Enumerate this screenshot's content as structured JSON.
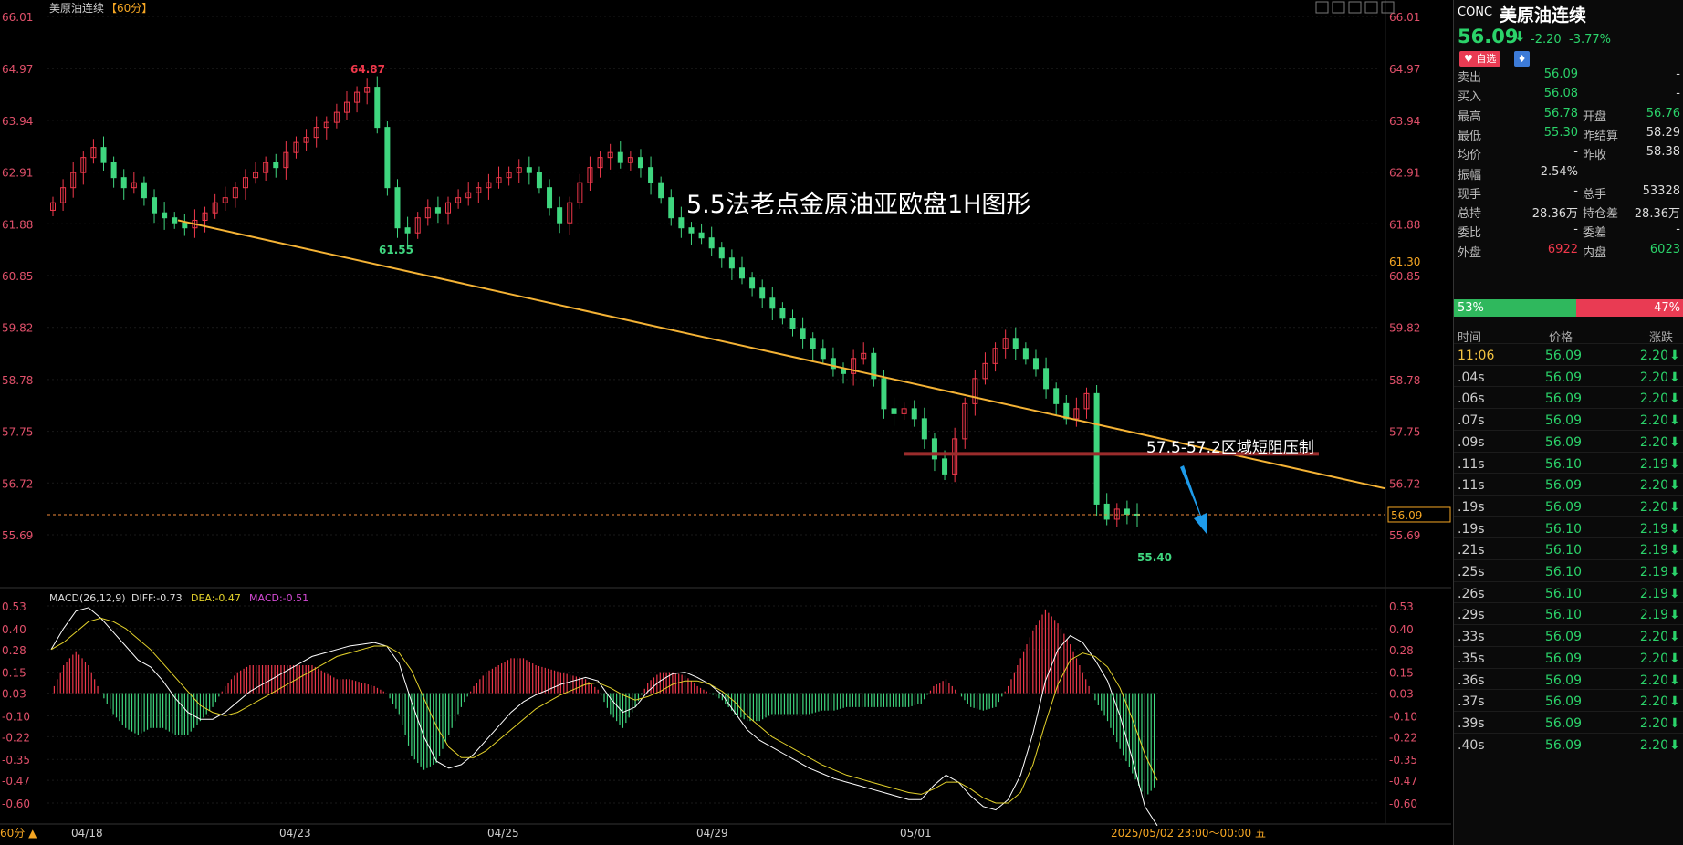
{
  "chart": {
    "title_symbol": "美原油连续",
    "title_period": "【60分】",
    "annotation_title": "5.5法老点金原油亚欧盘1H图形",
    "annotation_zone": "57.5-57.2区域短阻压制",
    "high_label": "64.87",
    "low_label_1": "61.55",
    "low_label_2": "55.40",
    "current_price_tag": "56.09",
    "crosshair_price_tag": "61.30",
    "period_button": "60分 ▲",
    "date_footer": "2025/05/02 23:00～00:00 五",
    "toolbar_icons": [
      "grid-icon",
      "split-icon",
      "zoom-icon",
      "panel-icon",
      "settings-icon"
    ]
  },
  "macd": {
    "label": "MACD(26,12,9)",
    "diff": "DIFF:-0.73",
    "dea": "DEA:-0.47",
    "macd": "MACD:-0.51"
  },
  "chart_data": {
    "type": "candlestick",
    "price_axis_ticks": [
      "66.01",
      "64.97",
      "63.94",
      "62.91",
      "61.88",
      "60.85",
      "59.82",
      "58.78",
      "57.75",
      "56.72",
      "55.69"
    ],
    "macd_axis_ticks": [
      "0.53",
      "0.40",
      "0.28",
      "0.15",
      "0.03",
      "-0.10",
      "-0.22",
      "-0.35",
      "-0.47",
      "-0.60"
    ],
    "date_ticks": [
      "04/18",
      "04/23",
      "04/25",
      "04/29",
      "05/01"
    ],
    "ylim": [
      55.4,
      66.01
    ],
    "closes": [
      62.3,
      62.6,
      62.9,
      63.2,
      63.4,
      63.1,
      62.8,
      62.6,
      62.7,
      62.4,
      62.1,
      62.0,
      61.9,
      61.8,
      61.95,
      62.1,
      62.3,
      62.4,
      62.6,
      62.8,
      62.9,
      63.1,
      63.0,
      63.3,
      63.5,
      63.6,
      63.8,
      63.9,
      64.1,
      64.3,
      64.5,
      64.6,
      63.8,
      62.6,
      61.8,
      61.7,
      62.0,
      62.2,
      62.1,
      62.3,
      62.4,
      62.5,
      62.6,
      62.7,
      62.8,
      62.9,
      63.0,
      62.9,
      62.6,
      62.2,
      61.9,
      62.3,
      62.7,
      63.0,
      63.2,
      63.3,
      63.1,
      63.2,
      63.0,
      62.7,
      62.4,
      62.0,
      61.8,
      61.7,
      61.6,
      61.4,
      61.2,
      61.0,
      60.8,
      60.6,
      60.4,
      60.2,
      60.0,
      59.8,
      59.6,
      59.4,
      59.2,
      59.0,
      58.9,
      59.2,
      59.3,
      58.8,
      58.2,
      58.1,
      58.2,
      58.0,
      57.6,
      57.2,
      56.9,
      57.6,
      58.3,
      58.8,
      59.1,
      59.4,
      59.6,
      59.4,
      59.2,
      59.0,
      58.6,
      58.3,
      58.0,
      58.2,
      58.5,
      56.3,
      56.0,
      56.2,
      56.1,
      56.09
    ],
    "series": [
      {
        "name": "DIFF",
        "values": [
          0.28,
          0.4,
          0.5,
          0.52,
          0.46,
          0.38,
          0.3,
          0.22,
          0.18,
          0.1,
          0.0,
          -0.08,
          -0.12,
          -0.12,
          -0.08,
          -0.02,
          0.04,
          0.08,
          0.12,
          0.16,
          0.2,
          0.24,
          0.26,
          0.28,
          0.3,
          0.31,
          0.32,
          0.3,
          0.2,
          -0.02,
          -0.22,
          -0.36,
          -0.4,
          -0.38,
          -0.32,
          -0.24,
          -0.16,
          -0.08,
          -0.02,
          0.02,
          0.05,
          0.08,
          0.1,
          0.12,
          0.1,
          0.0,
          -0.08,
          -0.05,
          0.04,
          0.1,
          0.14,
          0.15,
          0.12,
          0.08,
          0.02,
          -0.08,
          -0.18,
          -0.24,
          -0.28,
          -0.32,
          -0.36,
          -0.4,
          -0.43,
          -0.46,
          -0.48,
          -0.5,
          -0.52,
          -0.54,
          -0.56,
          -0.58,
          -0.58,
          -0.5,
          -0.44,
          -0.48,
          -0.56,
          -0.62,
          -0.64,
          -0.58,
          -0.44,
          -0.2,
          0.1,
          0.28,
          0.36,
          0.32,
          0.22,
          0.1,
          -0.1,
          -0.35,
          -0.62,
          -0.73
        ]
      },
      {
        "name": "DEA",
        "values": [
          0.28,
          0.32,
          0.38,
          0.44,
          0.46,
          0.44,
          0.4,
          0.34,
          0.28,
          0.2,
          0.12,
          0.04,
          -0.04,
          -0.08,
          -0.1,
          -0.08,
          -0.04,
          0.0,
          0.04,
          0.08,
          0.12,
          0.16,
          0.2,
          0.24,
          0.26,
          0.28,
          0.3,
          0.3,
          0.26,
          0.16,
          0.0,
          -0.16,
          -0.28,
          -0.34,
          -0.34,
          -0.3,
          -0.24,
          -0.18,
          -0.12,
          -0.06,
          -0.02,
          0.02,
          0.05,
          0.08,
          0.09,
          0.06,
          0.02,
          -0.01,
          0.01,
          0.04,
          0.08,
          0.1,
          0.1,
          0.08,
          0.04,
          -0.02,
          -0.1,
          -0.16,
          -0.22,
          -0.26,
          -0.3,
          -0.34,
          -0.38,
          -0.41,
          -0.44,
          -0.46,
          -0.48,
          -0.5,
          -0.52,
          -0.54,
          -0.55,
          -0.52,
          -0.48,
          -0.48,
          -0.52,
          -0.57,
          -0.6,
          -0.6,
          -0.54,
          -0.38,
          -0.14,
          0.08,
          0.22,
          0.26,
          0.24,
          0.18,
          0.06,
          -0.12,
          -0.32,
          -0.47
        ]
      }
    ]
  },
  "quote": {
    "code": "CONC",
    "name": "美原油连续",
    "price": "56.09",
    "arrow": "⬇",
    "change": "-2.20",
    "change_pct": "-3.77%",
    "fav_label": "♥ 自选",
    "bell_icon": "bell-icon",
    "rows": [
      {
        "l": "卖出",
        "v": "56.09",
        "vc": "green",
        "l2": "",
        "v2": "-",
        "v2c": "white"
      },
      {
        "l": "买入",
        "v": "56.08",
        "vc": "green",
        "l2": "",
        "v2": "-",
        "v2c": "white"
      },
      {
        "l": "最高",
        "v": "56.78",
        "vc": "green",
        "l2": "开盘",
        "v2": "56.76",
        "v2c": "green"
      },
      {
        "l": "最低",
        "v": "55.30",
        "vc": "green",
        "l2": "昨结算",
        "v2": "58.29",
        "v2c": "white"
      },
      {
        "l": "均价",
        "v": "-",
        "vc": "white",
        "l2": "昨收",
        "v2": "58.38",
        "v2c": "white"
      },
      {
        "l": "振幅",
        "v": "2.54%",
        "vc": "white",
        "l2": "",
        "v2": "",
        "v2c": "white"
      },
      {
        "l": "现手",
        "v": "-",
        "vc": "white",
        "l2": "总手",
        "v2": "53328",
        "v2c": "white"
      },
      {
        "l": "总持",
        "v": "28.36万",
        "vc": "white",
        "l2": "持仓差",
        "v2": "28.36万",
        "v2c": "white"
      },
      {
        "l": "委比",
        "v": "-",
        "vc": "white",
        "l2": "委差",
        "v2": "-",
        "v2c": "white"
      },
      {
        "l": "外盘",
        "v": "6922",
        "vc": "red",
        "l2": "内盘",
        "v2": "6023",
        "v2c": "green"
      }
    ],
    "buy_ratio": "53%",
    "sell_ratio": "47%",
    "tick_headers": [
      "时间",
      "价格",
      "涨跌"
    ],
    "ticks": [
      {
        "t": "11:06",
        "p": "56.09",
        "c": "2.20"
      },
      {
        "t": ".04s",
        "p": "56.09",
        "c": "2.20"
      },
      {
        "t": ".06s",
        "p": "56.09",
        "c": "2.20"
      },
      {
        "t": ".07s",
        "p": "56.09",
        "c": "2.20"
      },
      {
        "t": ".09s",
        "p": "56.09",
        "c": "2.20"
      },
      {
        "t": ".11s",
        "p": "56.10",
        "c": "2.19"
      },
      {
        "t": ".11s",
        "p": "56.09",
        "c": "2.20"
      },
      {
        "t": ".19s",
        "p": "56.09",
        "c": "2.20"
      },
      {
        "t": ".19s",
        "p": "56.10",
        "c": "2.19"
      },
      {
        "t": ".21s",
        "p": "56.10",
        "c": "2.19"
      },
      {
        "t": ".25s",
        "p": "56.10",
        "c": "2.19"
      },
      {
        "t": ".26s",
        "p": "56.10",
        "c": "2.19"
      },
      {
        "t": ".29s",
        "p": "56.10",
        "c": "2.19"
      },
      {
        "t": ".33s",
        "p": "56.09",
        "c": "2.20"
      },
      {
        "t": ".35s",
        "p": "56.09",
        "c": "2.20"
      },
      {
        "t": ".36s",
        "p": "56.09",
        "c": "2.20"
      },
      {
        "t": ".37s",
        "p": "56.09",
        "c": "2.20"
      },
      {
        "t": ".39s",
        "p": "56.09",
        "c": "2.20"
      },
      {
        "t": ".40s",
        "p": "56.09",
        "c": "2.20"
      }
    ]
  }
}
